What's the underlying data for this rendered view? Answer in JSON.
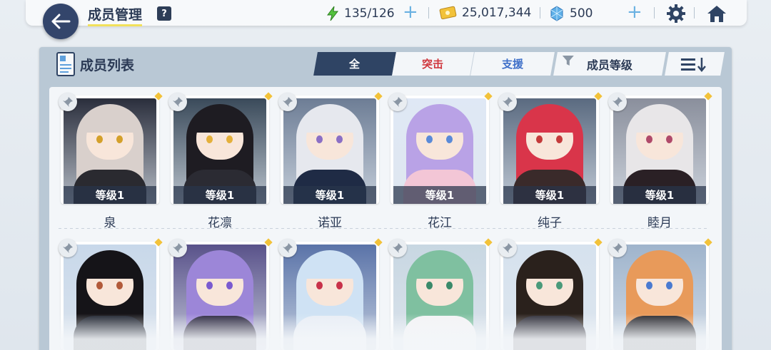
{
  "header": {
    "title": "成员管理",
    "help": "?",
    "ap": "135/126",
    "credits": "25,017,344",
    "pyroxene": "500",
    "plus": "+"
  },
  "panel": {
    "title": "成员列表",
    "tabs": [
      "全",
      "突击",
      "支援"
    ],
    "sort_label": "成员等级"
  },
  "colors": {
    "accent": "#2f4464",
    "striker": "#d0373e",
    "special": "#3e6fc9",
    "ap_icon": "#54c23e",
    "credit_icon": "#f2c23a",
    "pyroxene_icon": "#5fb0e8"
  },
  "students": [
    {
      "name": "泉",
      "level": "等级1",
      "hair": "#d9d0cc",
      "bg": "#2a2e3c",
      "eye": "#d4a02a",
      "outfit": "#2a2a30"
    },
    {
      "name": "花凛",
      "level": "等级1",
      "hair": "#1e1c22",
      "bg": "#3a4a5a",
      "eye": "#e4b03a",
      "outfit": "#2b2b33"
    },
    {
      "name": "诺亚",
      "level": "等级1",
      "hair": "#e6e8ee",
      "bg": "#6d7d95",
      "eye": "#8b6fc5",
      "outfit": "#1f2b45"
    },
    {
      "name": "花江",
      "level": "等级1",
      "hair": "#b9a2e6",
      "bg": "#dfe8f5",
      "eye": "#5a8ad8",
      "outfit": "#f3c6d6"
    },
    {
      "name": "纯子",
      "level": "等级1",
      "hair": "#d9354a",
      "bg": "#5a6a80",
      "eye": "#c43a3a",
      "outfit": "#3a2a2a"
    },
    {
      "name": "睦月",
      "level": "等级1",
      "hair": "#e8e6e8",
      "bg": "#8a8f9c",
      "eye": "#b04a6a",
      "outfit": "#2a2025"
    },
    {
      "name": "",
      "level": "",
      "hair": "#151418",
      "bg": "#c8d8ea",
      "eye": "#b25a3a",
      "outfit": "#1f2430"
    },
    {
      "name": "",
      "level": "",
      "hair": "#9c86d8",
      "bg": "#59528a",
      "eye": "#7a5ad0",
      "outfit": "#2b2740"
    },
    {
      "name": "",
      "level": "",
      "hair": "#cfe2f4",
      "bg": "#5a73a8",
      "eye": "#c8324a",
      "outfit": "#e9eef6"
    },
    {
      "name": "",
      "level": "",
      "hair": "#7fc0a0",
      "bg": "#c8d7e2",
      "eye": "#3a8a6a",
      "outfit": "#f4f4f6"
    },
    {
      "name": "",
      "level": "",
      "hair": "#2a211c",
      "bg": "#d6e2ee",
      "eye": "#4a9a7a",
      "outfit": "#2d2d38"
    },
    {
      "name": "",
      "level": "",
      "hair": "#e89a5a",
      "bg": "#9fb4cc",
      "eye": "#4a7ad0",
      "outfit": "#2a2a30"
    }
  ]
}
